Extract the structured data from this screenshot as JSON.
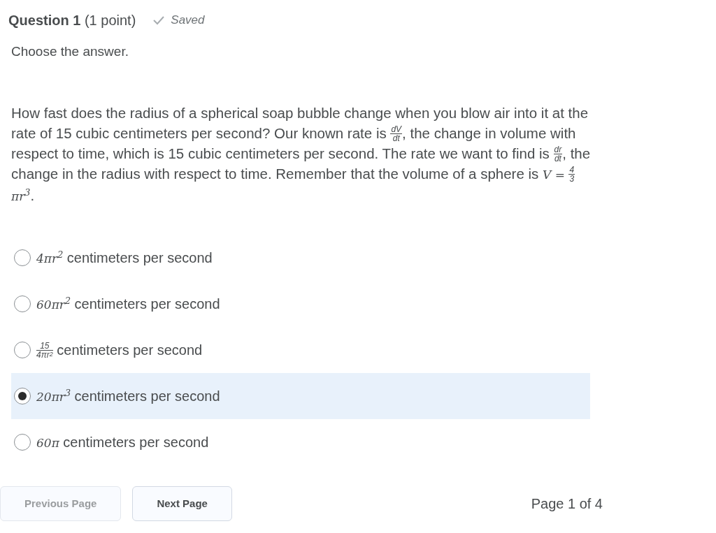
{
  "question": {
    "title": "Question 1",
    "points": "(1 point)",
    "status": "Saved"
  },
  "instruction": "Choose the answer.",
  "prompt": [
    {
      "kind": "text",
      "text": "How fast does the radius of a spherical soap bubble change when you blow air into it at the rate of 15 cubic centimeters per second? Our known rate is "
    },
    {
      "kind": "frac",
      "num": "dV",
      "den": "dt"
    },
    {
      "kind": "text",
      "text": ", the change in volume with respect to time, which is 15 cubic centimeters per second. The rate we want to find is "
    },
    {
      "kind": "frac",
      "num": "dr",
      "den": "dt"
    },
    {
      "kind": "text",
      "text": ", the change in the radius with respect to time. Remember that the volume of a sphere is "
    },
    {
      "kind": "math",
      "text": "V = "
    },
    {
      "kind": "frac",
      "num": "4",
      "den": "3"
    },
    {
      "kind": "math",
      "text": "πr$^{3}$"
    },
    {
      "kind": "text",
      "text": "."
    }
  ],
  "options": [
    {
      "selected": false,
      "math": [
        {
          "kind": "math",
          "text": "4πr$^{2}$"
        }
      ],
      "text": "centimeters per second"
    },
    {
      "selected": false,
      "math": [
        {
          "kind": "math",
          "text": "60πr$^{2}$"
        }
      ],
      "text": "centimeters per second"
    },
    {
      "selected": false,
      "math": [
        {
          "kind": "frac",
          "num": "15",
          "den": "4πr$^{2}$"
        }
      ],
      "text": "centimeters per second"
    },
    {
      "selected": true,
      "math": [
        {
          "kind": "math",
          "text": "20πr$^{3}$"
        }
      ],
      "text": "centimeters per second"
    },
    {
      "selected": false,
      "math": [
        {
          "kind": "math",
          "text": "60π"
        }
      ],
      "text": "centimeters per second"
    }
  ],
  "pager": {
    "buttons": [
      {
        "label": "Previous Page",
        "disabled": true
      },
      {
        "label": "Next Page",
        "disabled": false
      }
    ],
    "page": "Page 1 of 4"
  }
}
